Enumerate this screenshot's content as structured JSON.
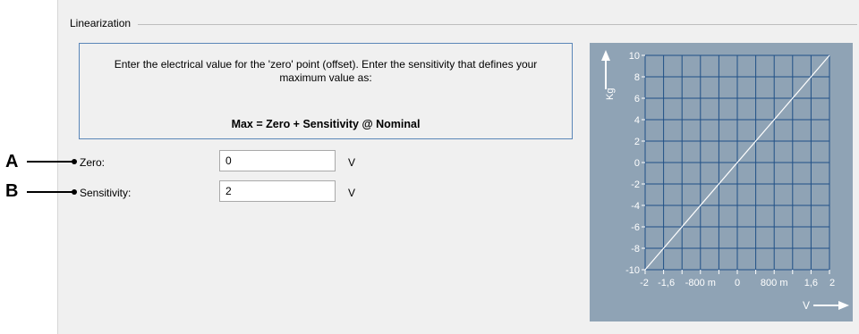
{
  "group": {
    "title": "Linearization"
  },
  "info": {
    "text": "Enter the electrical value for the 'zero' point (offset). Enter the sensitivity that defines your maximum value as:",
    "formula": "Max = Zero + Sensitivity @ Nominal"
  },
  "fields": {
    "zero": {
      "label": "Zero:",
      "value": "0",
      "unit": "V"
    },
    "sensitivity": {
      "label": "Sensitivity:",
      "value": "2",
      "unit": "V"
    }
  },
  "callouts": {
    "a": "A",
    "b": "B"
  },
  "colors": {
    "chart_bg": "#8fa3b5",
    "chart_grid": "#1f4f86",
    "chart_line": "#ffffff",
    "info_border": "#5a86b8"
  },
  "chart_data": {
    "type": "line",
    "xlabel": "V",
    "ylabel": "Kg",
    "xlim": [
      -2,
      2
    ],
    "ylim": [
      -10,
      10
    ],
    "x_ticks": [
      "-2",
      "-1,6",
      "-800 m",
      "0",
      "800 m",
      "1,6",
      "2"
    ],
    "y_ticks": [
      "10",
      "8",
      "6",
      "4",
      "2",
      "0",
      "-2",
      "-4",
      "-6",
      "-8",
      "-10"
    ],
    "grid": true,
    "series": [
      {
        "x": [
          -2,
          2
        ],
        "y": [
          -10,
          10
        ]
      }
    ]
  }
}
